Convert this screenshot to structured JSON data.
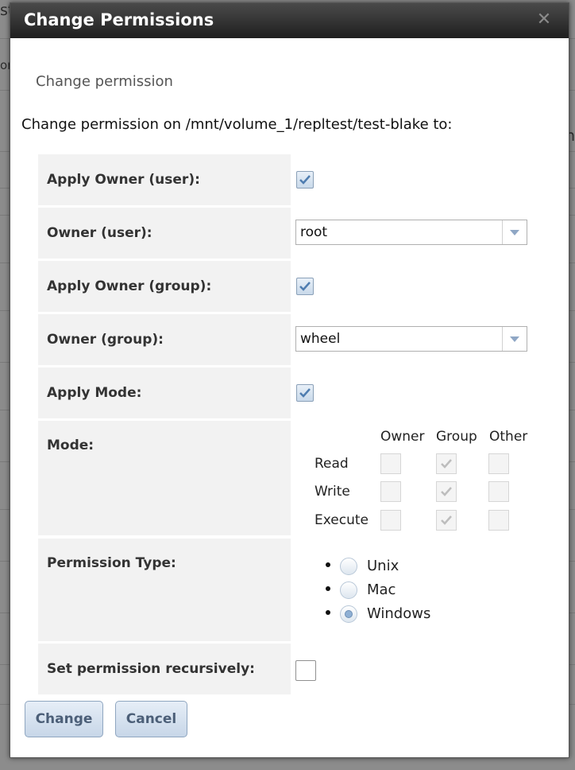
{
  "background": {
    "fragment_1": "st",
    "fragment_2": "or",
    "fragment_3": "n"
  },
  "dialog": {
    "title": "Change Permissions",
    "close_icon": "close-icon",
    "subtitle": "Change permission",
    "intro": "Change permission on /mnt/volume_1/repltest/test-blake to:"
  },
  "form": {
    "apply_owner_user": {
      "label": "Apply Owner (user):",
      "checked": true
    },
    "owner_user": {
      "label": "Owner (user):",
      "value": "root"
    },
    "apply_owner_group": {
      "label": "Apply Owner (group):",
      "checked": true
    },
    "owner_group": {
      "label": "Owner (group):",
      "value": "wheel"
    },
    "apply_mode": {
      "label": "Apply Mode:",
      "checked": true
    },
    "mode": {
      "label": "Mode:",
      "columns": [
        "Owner",
        "Group",
        "Other"
      ],
      "rows": [
        {
          "name": "Read",
          "owner": false,
          "group": true,
          "other": false
        },
        {
          "name": "Write",
          "owner": false,
          "group": true,
          "other": false
        },
        {
          "name": "Execute",
          "owner": false,
          "group": true,
          "other": false
        }
      ]
    },
    "permission_type": {
      "label": "Permission Type:",
      "options": [
        "Unix",
        "Mac",
        "Windows"
      ],
      "selected": "Windows"
    },
    "recursive": {
      "label": "Set permission recursively:",
      "checked": false
    }
  },
  "buttons": {
    "change": "Change",
    "cancel": "Cancel"
  },
  "colors": {
    "title_bar": "#1f1f1f",
    "label_background": "#f2f2f2",
    "button_text": "#4c5f78"
  }
}
